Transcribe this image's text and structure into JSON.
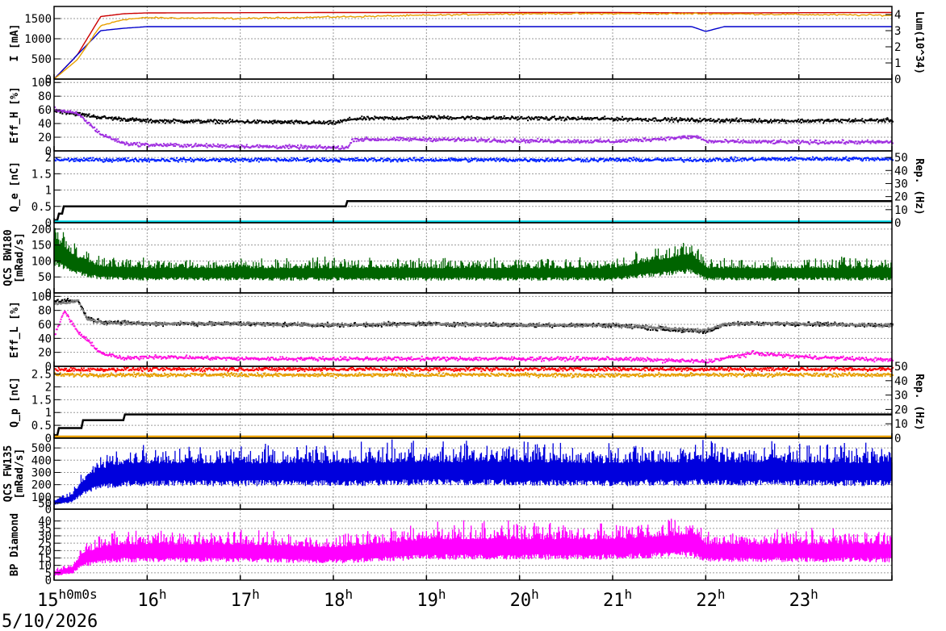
{
  "date_label": "5/10/2026",
  "time_axis": {
    "start_label": "15",
    "start_suffix": "h0m0s",
    "labels": [
      "16",
      "17",
      "18",
      "19",
      "20",
      "21",
      "22",
      "23"
    ],
    "suffix": "h",
    "range_hours": [
      15.0,
      24.0
    ]
  },
  "chart_data": [
    {
      "type": "line",
      "ylabel": "I [mA]",
      "ylim": [
        0,
        1800
      ],
      "yticks": [
        0,
        500,
        1000,
        1500
      ],
      "y2label": "Lum(10^34)",
      "y2lim": [
        0,
        4.5
      ],
      "y2ticks": [
        0,
        1,
        2,
        3,
        4
      ],
      "grid": true,
      "series": [
        {
          "color": "#cc0000",
          "x": [
            15.0,
            15.25,
            15.5,
            15.75,
            16.0,
            18.0,
            21.0,
            22.0,
            24.0
          ],
          "y": [
            0,
            600,
            1550,
            1620,
            1640,
            1650,
            1650,
            1640,
            1650
          ]
        },
        {
          "color": "#0000cc",
          "x": [
            15.0,
            15.25,
            15.5,
            15.75,
            16.0,
            18.0,
            21.0,
            21.85,
            22.0,
            22.2,
            24.0
          ],
          "y": [
            0,
            600,
            1200,
            1260,
            1300,
            1300,
            1300,
            1300,
            1180,
            1300,
            1300
          ]
        },
        {
          "color": "#e8a000",
          "axis": "y2",
          "x": [
            15.0,
            15.25,
            15.5,
            15.75,
            16.0,
            17.0,
            18.0,
            19.0,
            20.0,
            21.0,
            22.0,
            23.0,
            24.0
          ],
          "y": [
            0,
            1.2,
            3.3,
            3.7,
            3.8,
            3.75,
            3.85,
            3.95,
            4.05,
            4.05,
            4.05,
            4.0,
            3.95
          ]
        }
      ]
    },
    {
      "type": "scatter",
      "ylabel": "Eff_H [%]",
      "ylim": [
        0,
        105
      ],
      "yticks": [
        0,
        20,
        40,
        60,
        80,
        100
      ],
      "grid": true,
      "series": [
        {
          "color": "#000000",
          "x": [
            15.0,
            15.25,
            15.5,
            16.0,
            17.0,
            18.0,
            18.2,
            19.0,
            20.0,
            21.0,
            22.0,
            23.0,
            24.0
          ],
          "y": [
            60,
            55,
            50,
            45,
            44,
            42,
            48,
            50,
            49,
            48,
            46,
            45,
            46
          ]
        },
        {
          "color": "#a030e0",
          "x": [
            15.0,
            15.25,
            15.5,
            15.75,
            16.0,
            17.0,
            18.0,
            18.15,
            18.2,
            19.0,
            20.0,
            21.0,
            21.9,
            22.0,
            23.0,
            24.0
          ],
          "y": [
            62,
            55,
            25,
            12,
            10,
            8,
            6,
            6,
            18,
            18,
            16,
            15,
            22,
            15,
            14,
            14
          ]
        }
      ]
    },
    {
      "type": "scatter",
      "ylabel": "Q_e [nC]",
      "ylim": [
        0,
        2.2
      ],
      "yticks": [
        0,
        0.5,
        1,
        1.5,
        2
      ],
      "y2label": "Rep. (Hz)",
      "y2lim": [
        0,
        55
      ],
      "y2ticks": [
        0,
        10,
        20,
        30,
        40,
        50
      ],
      "grid": true,
      "series": [
        {
          "color": "#0022ff",
          "x": [
            15.0,
            16.0,
            17.0,
            18.0,
            19.0,
            20.0,
            21.0,
            22.0,
            23.0,
            24.0
          ],
          "y": [
            1.95,
            1.95,
            1.95,
            1.95,
            1.95,
            1.95,
            1.95,
            1.95,
            1.98,
            1.98
          ]
        },
        {
          "color": "#000000",
          "axis": "y2",
          "step": true,
          "x": [
            15.0,
            15.05,
            15.1,
            18.15,
            24.0
          ],
          "y": [
            2,
            7,
            12.5,
            16.5,
            16.5
          ]
        },
        {
          "color": "#00d8e8",
          "axis": "y2",
          "x": [
            15.0,
            24.0
          ],
          "y": [
            0.8,
            0.8
          ]
        }
      ]
    },
    {
      "type": "bar",
      "ylabel": "QCS BW180 [mRad/s]",
      "ylim": [
        0,
        220
      ],
      "yticks": [
        0,
        50,
        100,
        150,
        200
      ],
      "grid": true,
      "series": [
        {
          "color": "#006400",
          "x": [
            15.0,
            15.25,
            15.5,
            16.0,
            17.0,
            18.0,
            19.0,
            20.0,
            21.0,
            21.85,
            22.0,
            23.0,
            24.0
          ],
          "y": [
            150,
            100,
            75,
            70,
            70,
            70,
            70,
            70,
            70,
            110,
            70,
            70,
            70
          ]
        }
      ]
    },
    {
      "type": "scatter",
      "ylabel": "Eff_L [%]",
      "ylim": [
        0,
        105
      ],
      "yticks": [
        0,
        20,
        40,
        60,
        80,
        100
      ],
      "grid": true,
      "series": [
        {
          "color": "#000000",
          "x": [
            15.0,
            15.25,
            15.35,
            15.5,
            16.0,
            17.0,
            18.0,
            19.0,
            20.0,
            21.0,
            22.0,
            22.2,
            23.0,
            24.0
          ],
          "y": [
            95,
            95,
            70,
            65,
            62,
            62,
            60,
            62,
            60,
            60,
            50,
            62,
            62,
            60
          ]
        },
        {
          "color": "#808080",
          "x": [
            15.0,
            15.25,
            15.35,
            15.5,
            16.0,
            17.0,
            18.0,
            19.0,
            20.0,
            21.0,
            22.0,
            22.2,
            23.0,
            24.0
          ],
          "y": [
            90,
            95,
            68,
            64,
            62,
            62,
            60,
            62,
            60,
            60,
            52,
            62,
            62,
            60
          ]
        },
        {
          "color": "#ff10e0",
          "x": [
            15.0,
            15.1,
            15.25,
            15.5,
            15.75,
            16.0,
            17.0,
            18.0,
            19.0,
            20.0,
            21.0,
            22.0,
            22.5,
            23.0,
            24.0
          ],
          "y": [
            45,
            80,
            50,
            20,
            12,
            15,
            12,
            12,
            12,
            12,
            12,
            8,
            20,
            15,
            10
          ]
        }
      ]
    },
    {
      "type": "scatter",
      "ylabel": "Q_p [nC]",
      "ylim": [
        0,
        2.8
      ],
      "yticks": [
        0,
        0.5,
        1,
        1.5,
        2,
        2.5
      ],
      "y2label": "Rep. (Hz)",
      "y2lim": [
        0,
        50
      ],
      "y2ticks": [
        0,
        10,
        20,
        30,
        40,
        50
      ],
      "grid": true,
      "series": [
        {
          "color": "#ff0000",
          "x": [
            15.0,
            16.0,
            17.0,
            18.0,
            19.0,
            20.0,
            21.0,
            22.0,
            23.0,
            24.0
          ],
          "y": [
            2.7,
            2.72,
            2.72,
            2.72,
            2.72,
            2.72,
            2.72,
            2.72,
            2.72,
            2.72
          ]
        },
        {
          "color": "#e8a000",
          "x": [
            15.0,
            16.0,
            17.0,
            18.0,
            19.0,
            20.0,
            21.0,
            22.0,
            23.0,
            24.0
          ],
          "y": [
            2.5,
            2.5,
            2.5,
            2.48,
            2.5,
            2.5,
            2.48,
            2.5,
            2.5,
            2.5
          ]
        },
        {
          "color": "#000000",
          "axis": "y2",
          "step": true,
          "x": [
            15.0,
            15.05,
            15.1,
            15.3,
            15.5,
            15.75,
            24.0
          ],
          "y": [
            2,
            7,
            7,
            12.5,
            12.5,
            16.5,
            16.5
          ]
        },
        {
          "color": "#e8a000",
          "axis": "y2",
          "x": [
            15.0,
            24.0
          ],
          "y": [
            1.0,
            1.0
          ]
        }
      ]
    },
    {
      "type": "bar",
      "ylabel": "QCS FW135 [mRad/s]",
      "ylim": [
        0,
        580
      ],
      "yticks": [
        0,
        50,
        100,
        200,
        300,
        400,
        500
      ],
      "grid": true,
      "series": [
        {
          "color": "#0000dd",
          "x": [
            15.0,
            15.2,
            15.3,
            15.5,
            15.75,
            16.0,
            17.0,
            18.0,
            19.0,
            20.0,
            21.0,
            22.0,
            23.0,
            24.0
          ],
          "y": [
            60,
            100,
            200,
            300,
            330,
            340,
            340,
            340,
            350,
            350,
            340,
            350,
            345,
            340
          ]
        }
      ]
    },
    {
      "type": "bar",
      "ylabel": "BP Diamond",
      "ylim": [
        0,
        48
      ],
      "yticks": [
        0,
        5,
        10,
        15,
        20,
        25,
        30,
        35,
        40
      ],
      "grid": true,
      "series": [
        {
          "color": "#ff00ff",
          "x": [
            15.0,
            15.2,
            15.3,
            15.5,
            15.75,
            16.0,
            17.0,
            18.0,
            19.0,
            20.0,
            21.0,
            21.85,
            22.0,
            23.0,
            24.0
          ],
          "y": [
            5,
            8,
            16,
            20,
            22,
            22,
            22,
            20,
            25,
            25,
            25,
            28,
            22,
            22,
            22
          ]
        }
      ]
    }
  ]
}
